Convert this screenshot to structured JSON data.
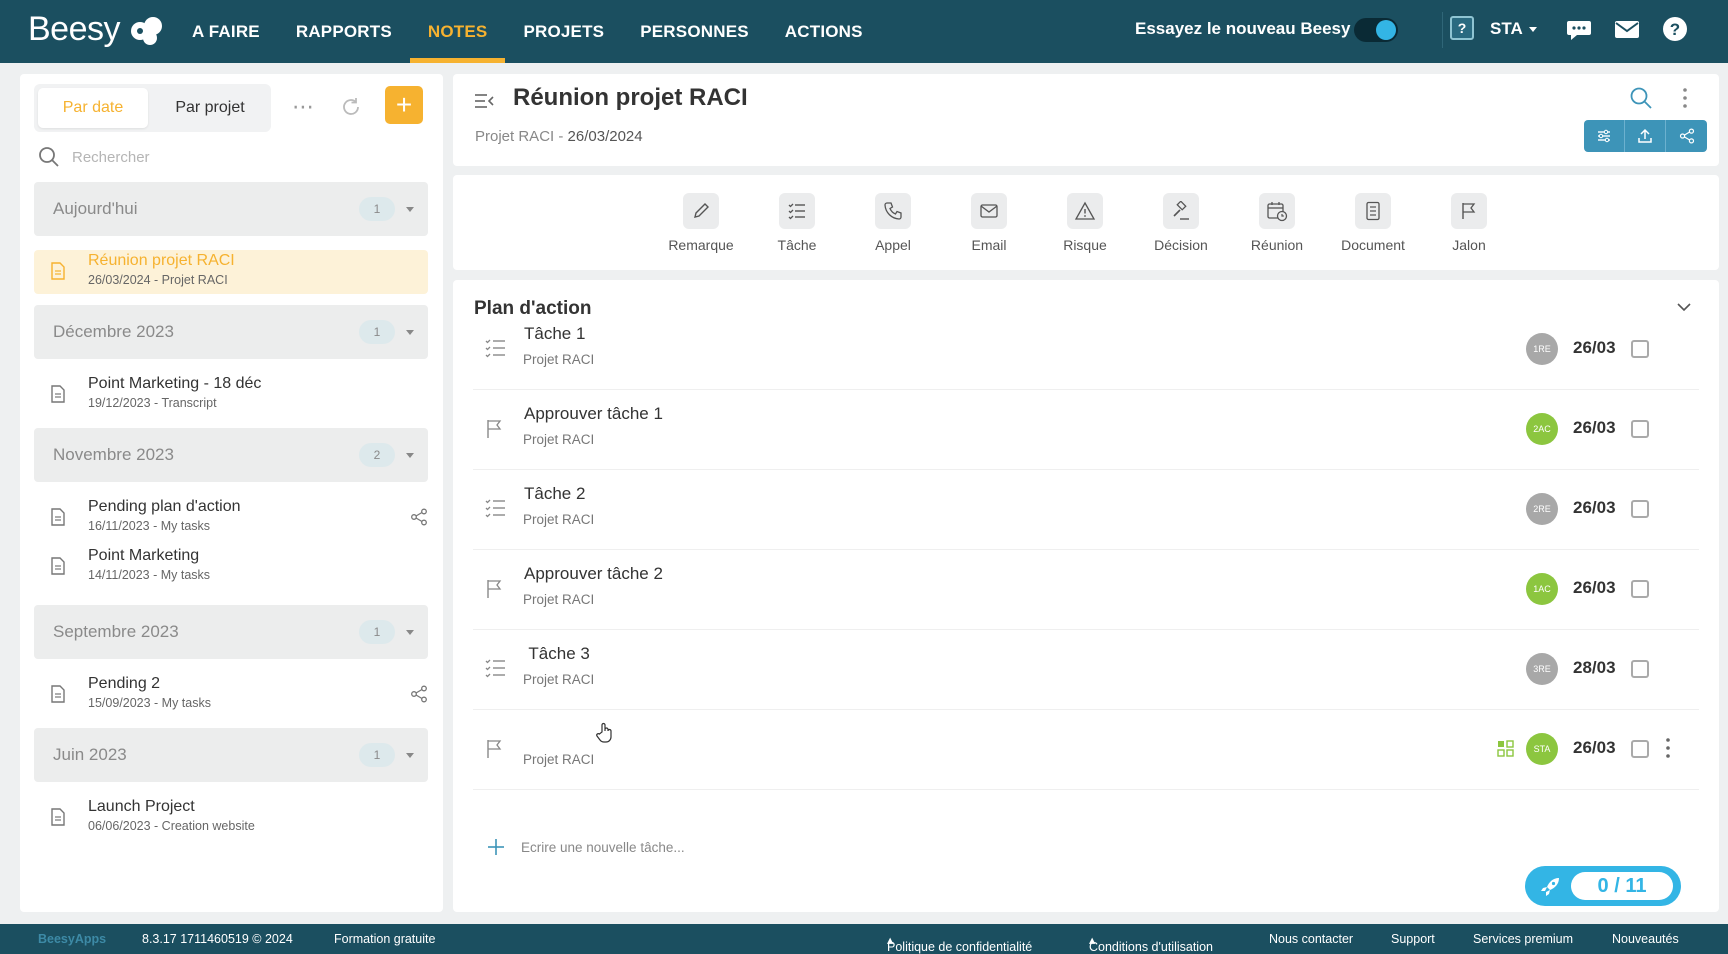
{
  "topbar": {
    "logo": "Beesy",
    "nav": [
      "A FAIRE",
      "RAPPORTS",
      "NOTES",
      "PROJETS",
      "PERSONNES",
      "ACTIONS"
    ],
    "active_nav": "NOTES",
    "try_new_label": "Essayez le nouveau Beesy",
    "try_new_toggle": "on",
    "user_initials": "STA",
    "icons": [
      "help-box-icon",
      "chat-icon",
      "mail-icon",
      "help-circle-icon"
    ]
  },
  "left": {
    "tab_by_date": "Par date",
    "tab_by_project": "Par projet",
    "active_tab": "Par date",
    "search_placeholder": "Rechercher",
    "groups": [
      {
        "label": "Aujourd'hui",
        "count": "1"
      },
      {
        "label": "Décembre 2023",
        "count": "1"
      },
      {
        "label": "Novembre 2023",
        "count": "2"
      },
      {
        "label": "Septembre 2023",
        "count": "1"
      },
      {
        "label": "Juin 2023",
        "count": "1"
      }
    ],
    "notes": [
      {
        "title": "Réunion projet RACI",
        "sub": "26/03/2024 - Projet RACI",
        "selected": true
      },
      {
        "title": "Point Marketing - 18 déc",
        "sub": "19/12/2023 - Transcript"
      },
      {
        "title": "Pending plan d'action",
        "sub": "16/11/2023 - My tasks",
        "shared": true
      },
      {
        "title": "Point Marketing",
        "sub": "14/11/2023 - My tasks"
      },
      {
        "title": "Pending 2",
        "sub": "15/09/2023 - My tasks",
        "shared": true
      },
      {
        "title": "Launch Project",
        "sub": "06/06/2023 - Creation website"
      }
    ]
  },
  "header": {
    "title": "Réunion projet RACI",
    "project": "Projet RACI",
    "date": "26/03/2024"
  },
  "types": [
    "Remarque",
    "Tâche",
    "Appel",
    "Email",
    "Risque",
    "Décision",
    "Réunion",
    "Document",
    "Jalon"
  ],
  "plan": {
    "title": "Plan d'action",
    "tasks": [
      {
        "kind": "task",
        "title": "Tâche 1",
        "project": "Projet RACI",
        "avatar": "1RE",
        "avatar_color": "#a8a8a8",
        "date": "26/03"
      },
      {
        "kind": "milestone",
        "title": "Approuver tâche 1",
        "project": "Projet RACI",
        "avatar": "2AC",
        "avatar_color": "#8cc63f",
        "date": "26/03"
      },
      {
        "kind": "task",
        "title": "Tâche 2",
        "project": "Projet RACI",
        "avatar": "2RE",
        "avatar_color": "#a8a8a8",
        "date": "26/03"
      },
      {
        "kind": "milestone",
        "title": "Approuver tâche 2",
        "project": "Projet RACI",
        "avatar": "1AC",
        "avatar_color": "#8cc63f",
        "date": "26/03"
      },
      {
        "kind": "task",
        "title": " Tâche 3",
        "project": "Projet RACI",
        "avatar": "3RE",
        "avatar_color": "#a8a8a8",
        "date": "28/03"
      },
      {
        "kind": "milestone",
        "title": "",
        "project": "Projet RACI",
        "avatar": "STA",
        "avatar_color": "#8cc63f",
        "date": "26/03"
      }
    ],
    "new_task_placeholder": "Ecrire une nouvelle tâche...",
    "progress": "0 / 11"
  },
  "footer": {
    "logo": "BeesyApps",
    "version": "8.3.17 1711460519 © 2024",
    "training": "Formation gratuite",
    "privacy": "Politique de confidentialité",
    "terms": "Conditions d'utilisation",
    "contact": "Nous contacter",
    "support": "Support",
    "premium": "Services premium",
    "news": "Nouveautés"
  },
  "colors": {
    "topbar": "#1b4f60",
    "accent": "#f6b230",
    "blue": "#33b5e5",
    "action_blue": "#3d94b8"
  }
}
